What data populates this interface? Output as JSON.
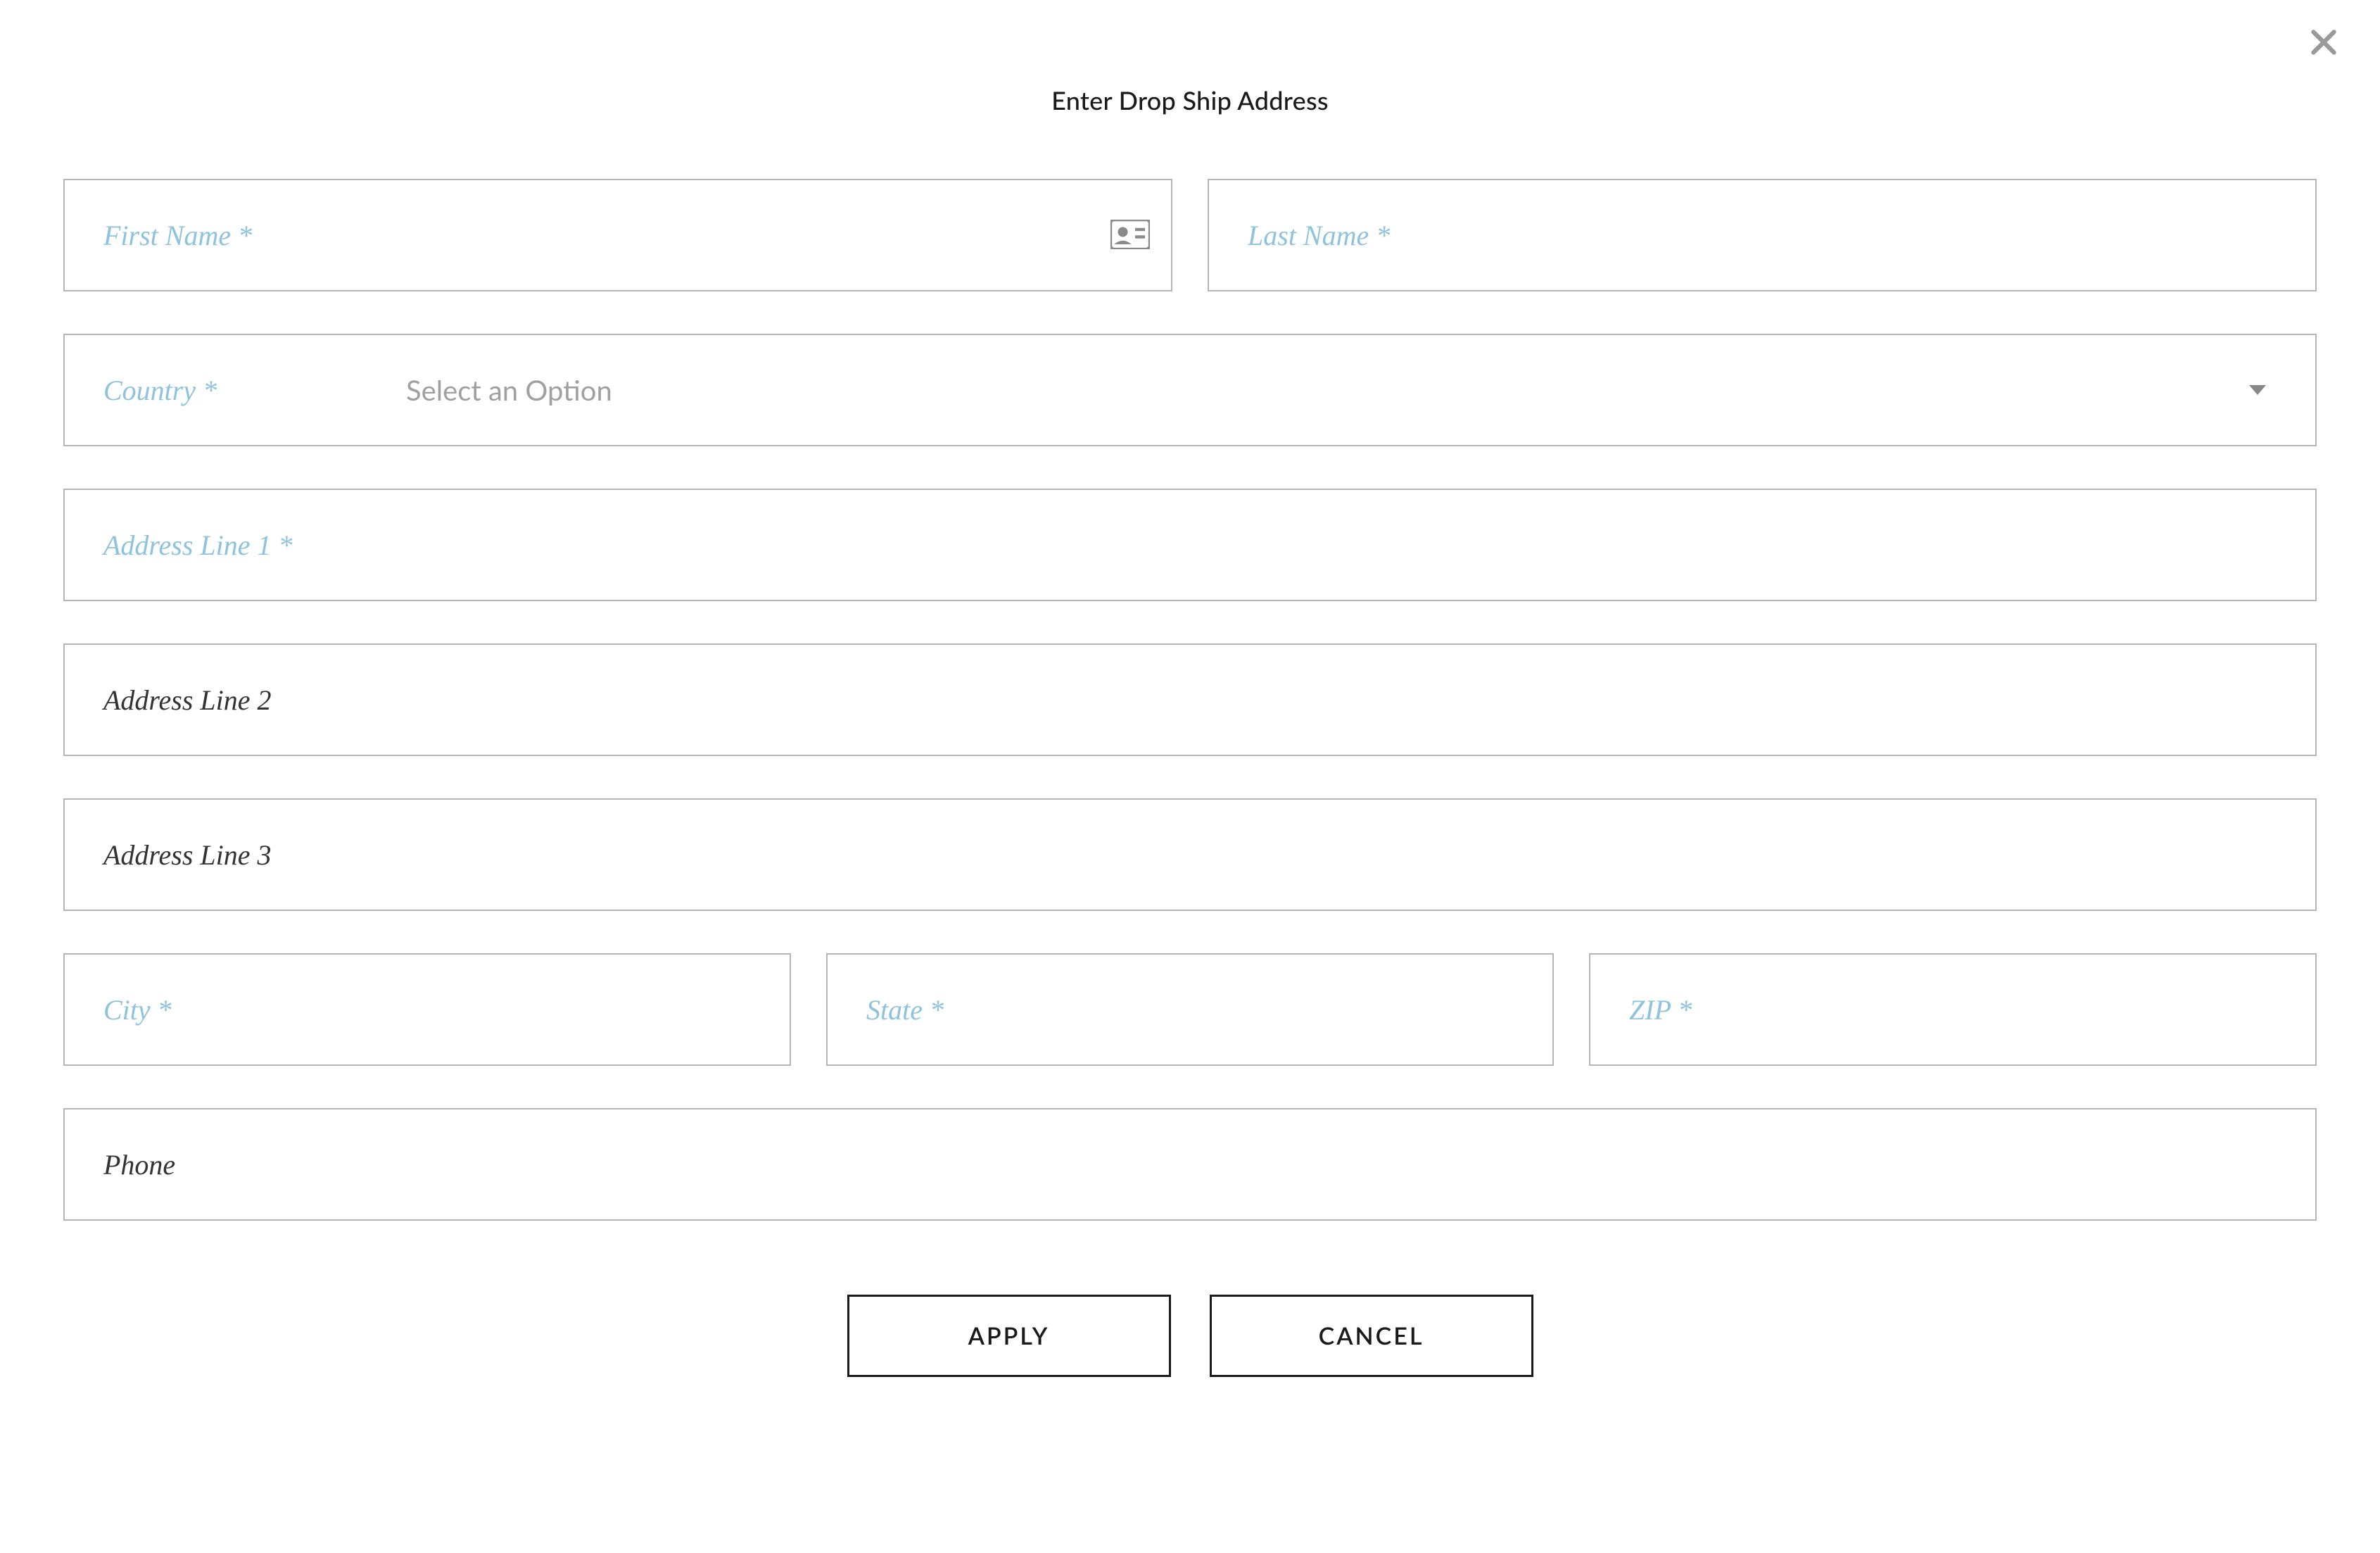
{
  "modal": {
    "title": "Enter Drop Ship Address",
    "close_label": "Close"
  },
  "fields": {
    "first_name": {
      "label": "First Name *",
      "value": ""
    },
    "last_name": {
      "label": "Last Name *",
      "value": ""
    },
    "country": {
      "label": "Country *",
      "placeholder": "Select an Option",
      "value": ""
    },
    "address1": {
      "label": "Address Line 1 *",
      "value": ""
    },
    "address2": {
      "label": "Address Line 2",
      "value": ""
    },
    "address3": {
      "label": "Address Line 3",
      "value": ""
    },
    "city": {
      "label": "City *",
      "value": ""
    },
    "state": {
      "label": "State *",
      "value": ""
    },
    "zip": {
      "label": "ZIP *",
      "value": ""
    },
    "phone": {
      "label": "Phone",
      "value": ""
    }
  },
  "buttons": {
    "apply": "APPLY",
    "cancel": "CANCEL"
  }
}
